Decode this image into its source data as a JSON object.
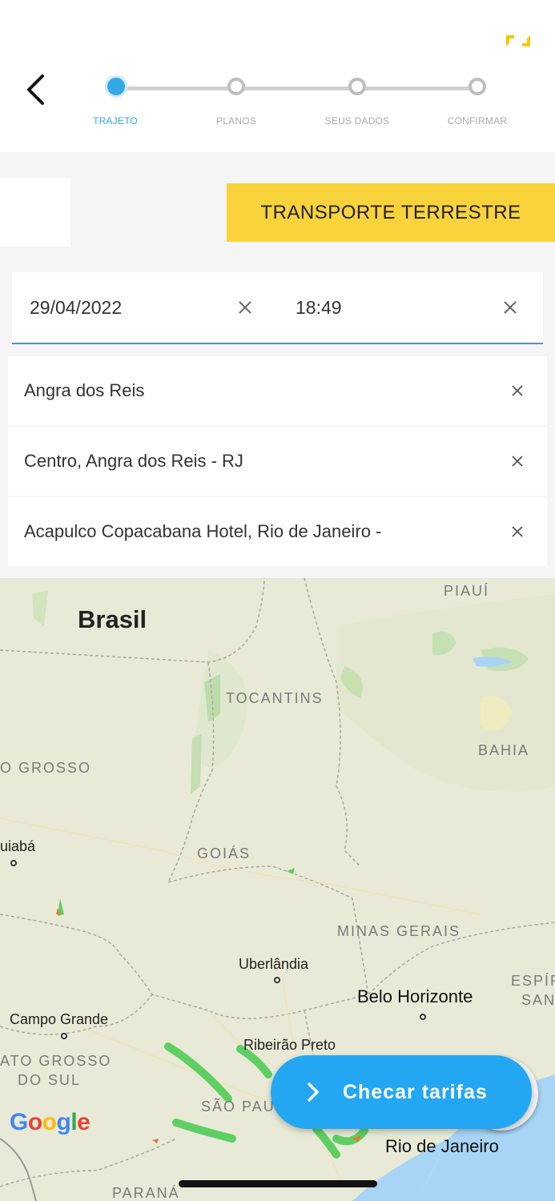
{
  "header": {
    "back_icon": "chevron-left-icon",
    "steps": [
      {
        "label": "TRAJETO",
        "active": true
      },
      {
        "label": "PLANOS",
        "active": false
      },
      {
        "label": "SEUS DADOS",
        "active": false
      },
      {
        "label": "CONFIRMAR",
        "active": false
      }
    ]
  },
  "tabs": {
    "transport_label": "TRANSPORTE TERRESTRE"
  },
  "datetime": {
    "date_value": "29/04/2022",
    "time_value": "18:49",
    "clear_icon": "close-icon"
  },
  "locations": [
    {
      "value": "Angra dos Reis"
    },
    {
      "value": "Centro, Angra dos Reis - RJ"
    },
    {
      "value": "Acapulco Copacabana Hotel, Rio de Janeiro -"
    }
  ],
  "map": {
    "country": "Brasil",
    "states": [
      "PIAUÍ",
      "TOCANTINS",
      "BAHIA",
      "O GROSSO",
      "GOIÁS",
      "MINAS GERAIS",
      "ATO GROSSO",
      "DO SUL",
      "SÃO PAU",
      "PARANÁ",
      "ESPÍR",
      "SAN"
    ],
    "cities": [
      "uiabá",
      "Uberlândia",
      "Belo Horizonte",
      "Campo Grande",
      "Ribeirão Preto",
      "Rio de Janeiro"
    ],
    "attribution": "Google"
  },
  "cta": {
    "label": "Checar tarifas",
    "icon": "chevron-right-icon"
  },
  "colors": {
    "accent_blue": "#34a8e6",
    "cta_blue": "#23a7f2",
    "tab_yellow": "#f9d33b",
    "underline_blue": "#4a90e2"
  }
}
